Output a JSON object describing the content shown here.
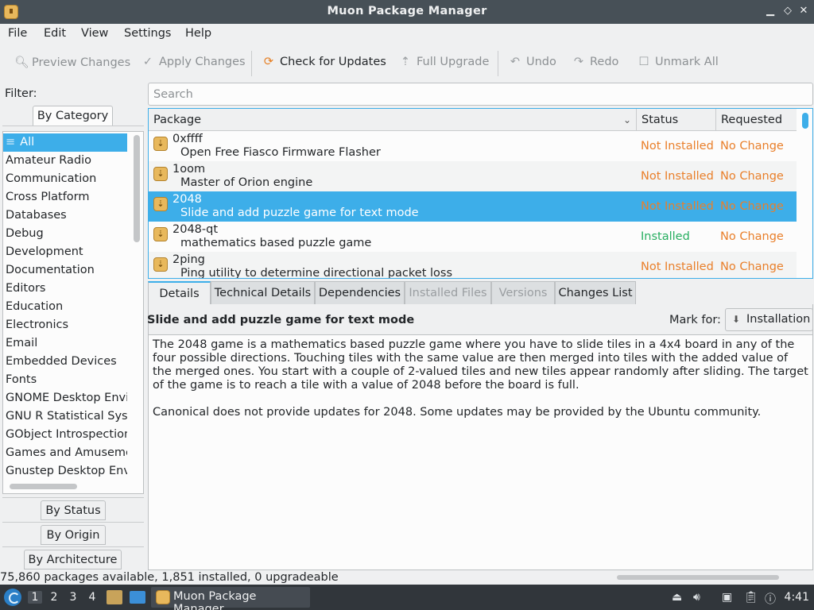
{
  "window": {
    "title": "Muon Package Manager",
    "minimize": "▁",
    "maximize": "◇",
    "close": "✕"
  },
  "menu": [
    "File",
    "Edit",
    "View",
    "Settings",
    "Help"
  ],
  "toolbar": {
    "preview": "Preview Changes",
    "apply": "Apply Changes",
    "check": "Check for Updates",
    "upgrade": "Full Upgrade",
    "undo": "Undo",
    "redo": "Redo",
    "unmark": "Unmark All"
  },
  "filter": {
    "label": "Filter:",
    "tabs": {
      "category": "By Category",
      "status": "By Status",
      "origin": "By Origin",
      "architecture": "By Architecture"
    },
    "categories": [
      "All",
      "Amateur Radio",
      "Communication",
      "Cross Platform",
      "Databases",
      "Debug",
      "Development",
      "Documentation",
      "Editors",
      "Education",
      "Electronics",
      "Email",
      "Embedded Devices",
      "Fonts",
      "GNOME Desktop Envir",
      "GNU R Statistical Syste",
      "GObject Introspection",
      "Games and Amusemen",
      "Gnustep Desktop Envi"
    ]
  },
  "search": {
    "placeholder": "Search"
  },
  "table": {
    "headers": {
      "package": "Package",
      "status": "Status",
      "requested": "Requested"
    },
    "rows": [
      {
        "name": "0xffff",
        "desc": "Open Free Fiasco Firmware Flasher",
        "status": "Not Installed",
        "requested": "No Change"
      },
      {
        "name": "1oom",
        "desc": "Master of Orion engine",
        "status": "Not Installed",
        "requested": "No Change"
      },
      {
        "name": "2048",
        "desc": "Slide and add puzzle game for text mode",
        "status": "Not Installed",
        "requested": "No Change"
      },
      {
        "name": "2048-qt",
        "desc": "mathematics based puzzle game",
        "status": "Installed",
        "requested": "No Change"
      },
      {
        "name": "2ping",
        "desc": "Ping utility to determine directional packet loss",
        "status": "Not Installed",
        "requested": "No Change"
      }
    ]
  },
  "details": {
    "tabs": [
      "Details",
      "Technical Details",
      "Dependencies",
      "Installed Files",
      "Versions",
      "Changes List"
    ],
    "title": "Slide and add puzzle game for text mode",
    "mark_for": "Mark for:",
    "install_button": "Installation",
    "description": [
      "The 2048 game is a mathematics based puzzle game where you have to slide tiles in a 4x4 board in any of the four possible directions. Touching tiles with the same value are then merged into tiles with the added value of the merged ones. You start with a couple of 2-valued tiles and new tiles appear randomly after sliding. The target of the game is to reach a tile with a value of 2048 before the board is full.",
      "Canonical does not provide updates for 2048. Some updates may be provided by the Ubuntu community."
    ]
  },
  "statusbar": "75,860 packages available, 1,851 installed, 0 upgradeable",
  "taskbar": {
    "workspaces": [
      "1",
      "2",
      "3",
      "4"
    ],
    "app": "Muon Package Manager",
    "clock": "4:41"
  },
  "colors": {
    "accent": "#3daee9",
    "not_installed": "#e97f2a",
    "installed": "#27ae60"
  }
}
